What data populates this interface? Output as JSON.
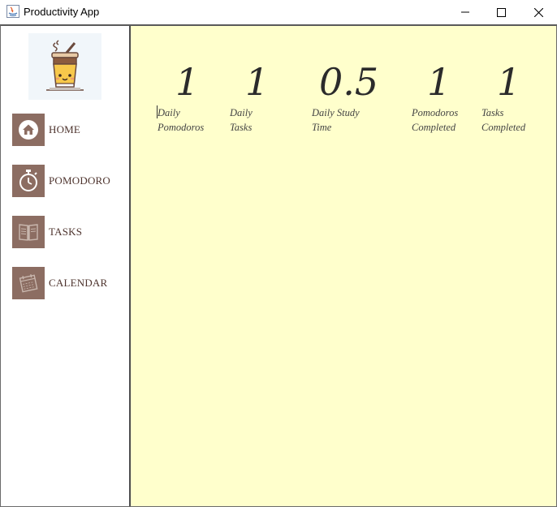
{
  "window": {
    "title": "Productivity App"
  },
  "sidebar": {
    "items": [
      {
        "label": "HOME",
        "icon": "home-icon"
      },
      {
        "label": "POMODORO",
        "icon": "stopwatch-icon"
      },
      {
        "label": "TASKS",
        "icon": "book-icon"
      },
      {
        "label": "CALENDAR",
        "icon": "calendar-icon"
      }
    ]
  },
  "stats": [
    {
      "value": "1",
      "label": "Daily\nPomodoros"
    },
    {
      "value": "1",
      "label": "Daily\nTasks"
    },
    {
      "value": "0.5",
      "label": "Daily Study\nTime"
    },
    {
      "value": "1",
      "label": "Pomodoros\nCompleted"
    },
    {
      "value": "1",
      "label": "Tasks\nCompleted"
    }
  ],
  "colors": {
    "sidebar_icon_bg": "#8c6d62",
    "content_bg": "#ffffcc",
    "nav_text": "#4e342e"
  }
}
